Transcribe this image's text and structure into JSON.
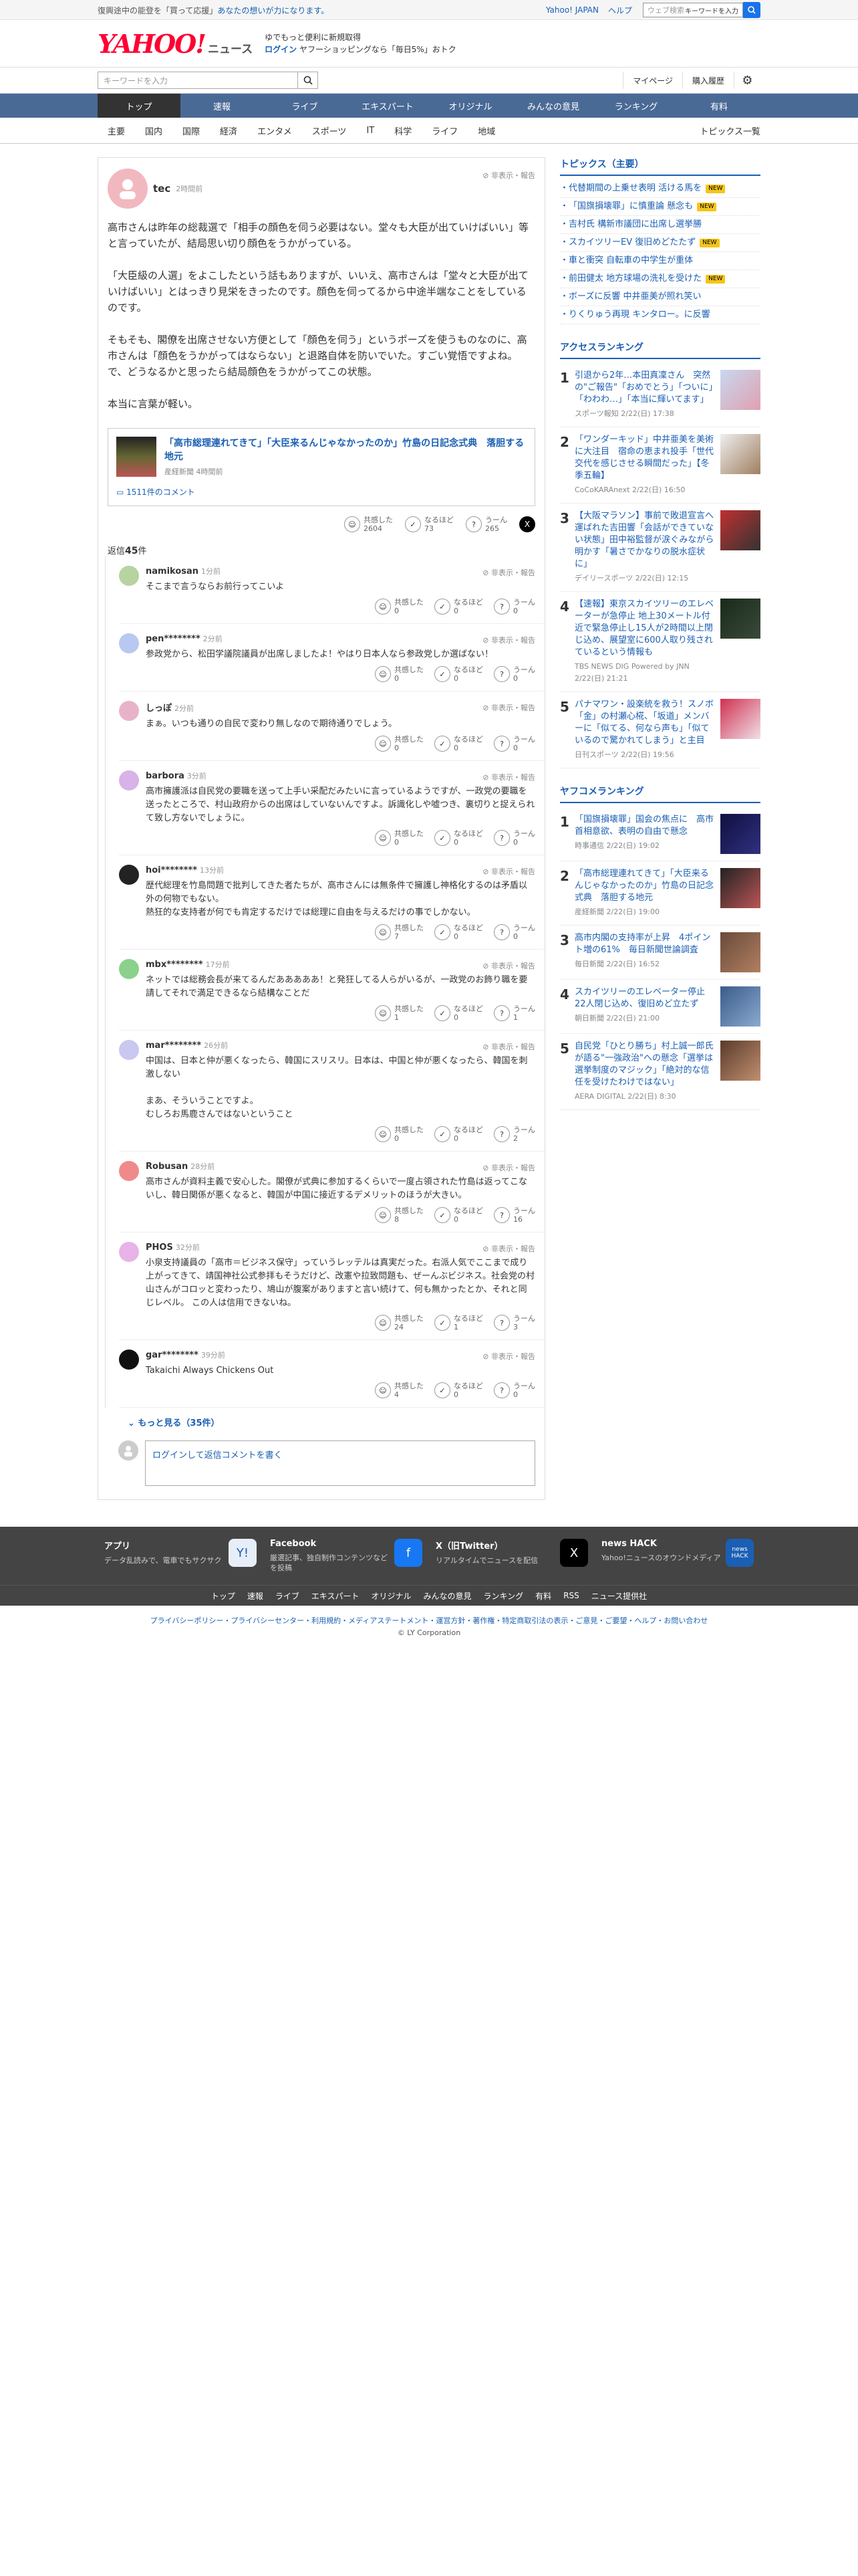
{
  "topbar": {
    "notice_pre": "復興途中の能登を「買って応援」",
    "notice_hl": "あなたの想いが力になります。",
    "links": [
      "Yahoo! JAPAN",
      "ヘルプ"
    ],
    "search_placeholder": "ウェブ検索",
    "search_tag": "キーワードを入力"
  },
  "header": {
    "logo_main": "YAHOO!",
    "logo_sub": "JAPAN",
    "logo_news": "ニュース",
    "promo1": "ゆでもっと便利に新規取得",
    "promo_login": "ログイン",
    "promo2": "ヤフーショッピングなら「毎日5%」おトク"
  },
  "searchrow": {
    "placeholder": "キーワードを入力",
    "mypage": "マイページ",
    "history": "購入履歴"
  },
  "gnav": [
    "トップ",
    "速報",
    "ライブ",
    "エキスパート",
    "オリジナル",
    "みんなの意見",
    "ランキング",
    "有料"
  ],
  "snav": [
    "主要",
    "国内",
    "国際",
    "経済",
    "エンタメ",
    "スポーツ",
    "IT",
    "科学",
    "ライフ",
    "地域"
  ],
  "snav_more": "トピックス一覧",
  "comment": {
    "user": "tec",
    "ago": "2時間前",
    "hide": "非表示・報告",
    "paragraphs": [
      "高市さんは昨年の総裁選で「相手の顔色を伺う必要はない。堂々も大臣が出ていけばいい」等と言っていたが、結局思い切り顔色をうかがっている。",
      "「大臣級の人選」をよこしたという話もありますが、いいえ、高市さんは「堂々と大臣が出ていけばいい」とはっきり見栄をきったのです。顔色を伺ってるから中途半端なことをしているのです。",
      "そもそも、閣僚を出席させない方便として「顔色を伺う」というポーズを使うものなのに、高市さんは「顔色をうかがってはならない」と退路自体を防いでいた。すごい覚悟ですよね。で、どうなるかと思ったら結局顔色をうかがってこの状態。",
      "本当に言葉が軽い。"
    ],
    "related_title": "「高市総理連れてきて」「大臣来るんじゃなかったのか」竹島の日記念式典　落胆する地元",
    "related_src": "産経新聞 4時間前",
    "related_comments": "1511件のコメント",
    "react": {
      "kyokan": "共感した",
      "kyokan_n": "2604",
      "naruhodo": "なるほど",
      "naruhodo_n": "73",
      "uun": "うーん",
      "uun_n": "265"
    }
  },
  "reply_header_pre": "返信",
  "reply_count": "45",
  "reply_header_post": "件",
  "replies": [
    {
      "user": "namikosan",
      "ago": "1分前",
      "text": "そこまで言うならお前行ってこいよ",
      "k": "0",
      "n": "0",
      "u": "0",
      "color": "#b7d3a0"
    },
    {
      "user": "pen********",
      "ago": "2分前",
      "text": "参政党から、松田学議院議員が出席しましたよ！やはり日本人なら参政党しか選ばない！",
      "k": "0",
      "n": "0",
      "u": "0",
      "color": "#b8c8f0"
    },
    {
      "user": "しっぽ",
      "ago": "2分前",
      "text": "まぁ。いつも通りの自民で変わり無しなので期待通りでしょう。",
      "k": "0",
      "n": "0",
      "u": "0",
      "color": "#e8b3c8"
    },
    {
      "user": "barbora",
      "ago": "3分前",
      "text": "高市擁護派は自民党の要職を送って上手い采配だみたいに言っているようですが、一政党の要職を送ったところで、村山政府からの出席はしていないんですよ。訴識化しや嘘つき、裏切りと捉えられて致し方ないでしょうに。",
      "k": "0",
      "n": "0",
      "u": "0",
      "color": "#d7b3e8"
    },
    {
      "user": "hoi********",
      "ago": "13分前",
      "text": "歴代総理を竹島問題で批判してきた者たちが、高市さんには無条件で擁護し神格化するのは矛盾以外の何物でもない。\n熱狂的な支持者が何でも肯定するだけでは総理に自由を与えるだけの事でしかない。",
      "k": "7",
      "n": "0",
      "u": "0",
      "color": "#222"
    },
    {
      "user": "mbx********",
      "ago": "17分前",
      "text": "ネットでは総務会長が来てるんだあああああ！と発狂してる人らがいるが、一政党のお飾り職を要請してそれで満足できるなら結構なことだ",
      "k": "1",
      "n": "0",
      "u": "1",
      "color": "#8bd08b"
    },
    {
      "user": "mar********",
      "ago": "26分前",
      "text": "中国は、日本と仲が悪くなったら、韓国にスリスリ。日本は、中国と仲が悪くなったら、韓国を刺激しない\n\nまあ、そういうことですよ。\nむしろお馬鹿さんではないということ",
      "k": "0",
      "n": "0",
      "u": "2",
      "color": "#c8c8f0"
    },
    {
      "user": "Robusan",
      "ago": "28分前",
      "text": "高市さんが資料主義で安心した。閣僚が式典に参加するくらいで一度占領された竹島は返ってこないし、韓日関係が悪くなると、韓国が中国に接近するデメリットのほうが大きい。",
      "k": "8",
      "n": "0",
      "u": "16",
      "color": "#f08a8a"
    },
    {
      "user": "PHOS",
      "ago": "32分前",
      "text": "小泉支持議員の「高市＝ビジネス保守」っていうレッテルは真実だった。右派人気でここまで成り上がってきて、靖国神社公式参拝もそうだけど、改憲や拉致問題も、ぜーんぶビジネス。社会党の村山さんがコロッと変わったり、鳩山が腹案がありますと言い続けて、何も無かったとか、それと同じレベル。 この人は信用できないね。",
      "k": "24",
      "n": "1",
      "u": "3",
      "color": "#e8b3e8"
    },
    {
      "user": "gar********",
      "ago": "39分前",
      "text": "Takaichi Always Chickens Out",
      "k": "4",
      "n": "0",
      "u": "0",
      "color": "#111"
    }
  ],
  "more_replies": "もっと見る（35件）",
  "reply_input": "ログインして返信コメントを書く",
  "side": {
    "topics_title": "トピックス（主要）",
    "topics": [
      {
        "t": "代替期間の上乗せ表明 活ける馬を",
        "new": true
      },
      {
        "t": "「国旗損壊罪」に慎重論 懸念も",
        "new": true
      },
      {
        "t": "吉村氏 構新市議団に出席し選挙勝",
        "new": false
      },
      {
        "t": "スカイツリーEV 復旧めどたたず",
        "new": true
      },
      {
        "t": "車と衝突 自転車の中学生が重体",
        "new": false
      },
      {
        "t": "前田健太 地方球場の洗礼を受けた",
        "new": true
      },
      {
        "t": "ボーズに反響 中井亜美が照れ笑い",
        "new": false
      },
      {
        "t": "りくりゅう再現 キンタロー。に反響",
        "new": false
      }
    ],
    "access_title": "アクセスランキング",
    "access": [
      {
        "n": "1",
        "t": "引退から2年…本田真凜さん　突然の\"ご報告\"「おめでとう」「ついに」「わわわ…」「本当に輝いてます」",
        "src": "スポーツ報知 2/22(日) 17:38",
        "c1": "#c8d8f0",
        "c2": "#e0a0b0"
      },
      {
        "n": "2",
        "t": "「ワンダーキッド」中井亜美を美術に大注目　宿命の恵まれ投手「世代交代を感じさせる瞬間だった」【冬季五輪】",
        "src": "CoCoKARAnext 2/22(日) 16:50",
        "c1": "#eee",
        "c2": "#a08060"
      },
      {
        "n": "3",
        "t": "【大阪マラソン】事前で敗退宣言へ運ばれた吉田響「会話ができていない状態」田中裕監督が涙ぐみながら明かす「暑さでかなりの脱水症状に」",
        "src": "デイリースポーツ 2/22(日) 12:15",
        "c1": "#c03030",
        "c2": "#333"
      },
      {
        "n": "4",
        "t": "【速報】東京スカイツリーのエレベーターが急停止 地上30メートル付近で緊急停止し15人が2時間以上閉じ込め、展望室に600人取り残されているという情報も",
        "src": "TBS NEWS DIG Powered by JNN 2/22(日) 21:21",
        "c1": "#1a2a1a",
        "c2": "#3a4a3a"
      },
      {
        "n": "5",
        "t": "パナマワン・設楽統を救う！スノボ「金」の村瀬心椛、「坂道」メンバーに「似てる、何なら声も」「似ているので驚かれてしまう」と主目",
        "src": "日刊スポーツ 2/22(日) 19:56",
        "c1": "#d03050",
        "c2": "#f0e0e8"
      }
    ],
    "yafuko_title": "ヤフコメランキング",
    "yafuko": [
      {
        "n": "1",
        "t": "「国旗損壊罪」国会の焦点に　高市首相意欲、表明の自由で懸念",
        "src": "時事通信 2/22(日) 19:02",
        "c1": "#101040",
        "c2": "#303080"
      },
      {
        "n": "2",
        "t": "「高市総理連れてきて」「大臣来るんじゃなかったのか」竹島の日記念式典　落胆する地元",
        "src": "産経新聞 2/22(日) 19:00",
        "c1": "#222",
        "c2": "#b55"
      },
      {
        "n": "3",
        "t": "高市内閣の支持率が上昇　4ポイント増の61%　毎日新聞世論調査",
        "src": "毎日新聞 2/22(日) 16:52",
        "c1": "#6a4a3a",
        "c2": "#b08060"
      },
      {
        "n": "4",
        "t": "スカイツリーのエレベーター停止 22人閉じ込め、復旧めど立たず",
        "src": "朝日新聞 2/22(日) 21:00",
        "c1": "#3a5a8a",
        "c2": "#8aaad0"
      },
      {
        "n": "5",
        "t": "自民党「ひとり勝ち」村上誠一郎氏が語る\"一強政治\"への懸念「選挙は選挙制度のマジック」「絶対的な信任を受けたわけではない」",
        "src": "AERA DIGITAL 2/22(日) 8:30",
        "c1": "#5a3a2a",
        "c2": "#c09070"
      }
    ]
  },
  "footer": {
    "cols": [
      {
        "h": "アプリ",
        "d": "データ乱読みで、電車でもサクサク",
        "icon": "news-app-icon",
        "bg": "#e8eef8",
        "glyph": "Y!"
      },
      {
        "h": "Facebook",
        "d": "厳選記事、独自制作コンテンツなどを投稿",
        "icon": "facebook-icon",
        "bg": "#1877f2",
        "glyph": "f"
      },
      {
        "h": "X（旧Twitter）",
        "d": "リアルタイムでニュースを配信",
        "icon": "x-icon",
        "bg": "#000",
        "glyph": "X"
      },
      {
        "h": "news HACK",
        "d": "Yahoo!ニュースのオウンドメディア",
        "icon": "newshack-icon",
        "bg": "#1a5fb4",
        "glyph": "news HACK"
      }
    ],
    "nav": [
      "トップ",
      "速報",
      "ライブ",
      "エキスパート",
      "オリジナル",
      "みんなの意見",
      "ランキング",
      "有料",
      "RSS",
      "ニュース提供社"
    ],
    "links": "プライバシーポリシー・プライバシーセンター・利用規約・メディアステートメント・運営方針・著作権・特定商取引法の表示・ご意見・ご要望・ヘルプ・お問い合わせ",
    "copyright": "© LY Corporation"
  }
}
